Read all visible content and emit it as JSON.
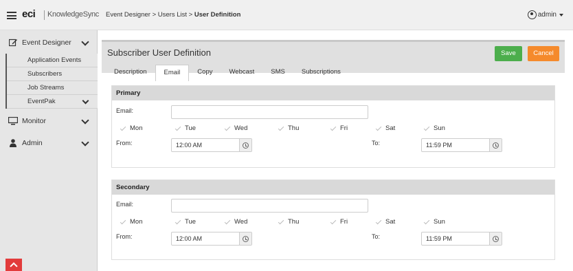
{
  "header": {
    "logo_brand": "eci",
    "logo_product": "KnowledgeSync",
    "breadcrumb_prefix": "Event Designer > Users List > ",
    "breadcrumb_current": "User Definition",
    "user_name": "admin"
  },
  "sidebar": {
    "sections": [
      {
        "label": "Event Designer",
        "icon": "edit-icon"
      },
      {
        "label": "Monitor",
        "icon": "monitor-icon"
      },
      {
        "label": "Admin",
        "icon": "user-icon"
      }
    ],
    "sub_items": [
      {
        "label": "Application Events"
      },
      {
        "label": "Subscribers"
      },
      {
        "label": "Job Streams"
      },
      {
        "label": "EventPak"
      }
    ]
  },
  "page": {
    "title": "Subscriber User Definition",
    "save_label": "Save",
    "cancel_label": "Cancel",
    "tabs": [
      {
        "label": "Description",
        "active": false
      },
      {
        "label": "Email",
        "active": true
      },
      {
        "label": "Copy",
        "active": false
      },
      {
        "label": "Webcast",
        "active": false
      },
      {
        "label": "SMS",
        "active": false
      },
      {
        "label": "Subscriptions",
        "active": false
      }
    ]
  },
  "primary": {
    "title": "Primary",
    "email_label": "Email:",
    "email_value": "",
    "days": [
      "Mon",
      "Tue",
      "Wed",
      "Thu",
      "Fri",
      "Sat",
      "Sun"
    ],
    "from_label": "From:",
    "from_value": "12:00 AM",
    "to_label": "To:",
    "to_value": "11:59 PM"
  },
  "secondary": {
    "title": "Secondary",
    "email_label": "Email:",
    "email_value": "",
    "days": [
      "Mon",
      "Tue",
      "Wed",
      "Thu",
      "Fri",
      "Sat",
      "Sun"
    ],
    "from_label": "From:",
    "from_value": "12:00 AM",
    "to_label": "To:",
    "to_value": "11:59 PM"
  }
}
